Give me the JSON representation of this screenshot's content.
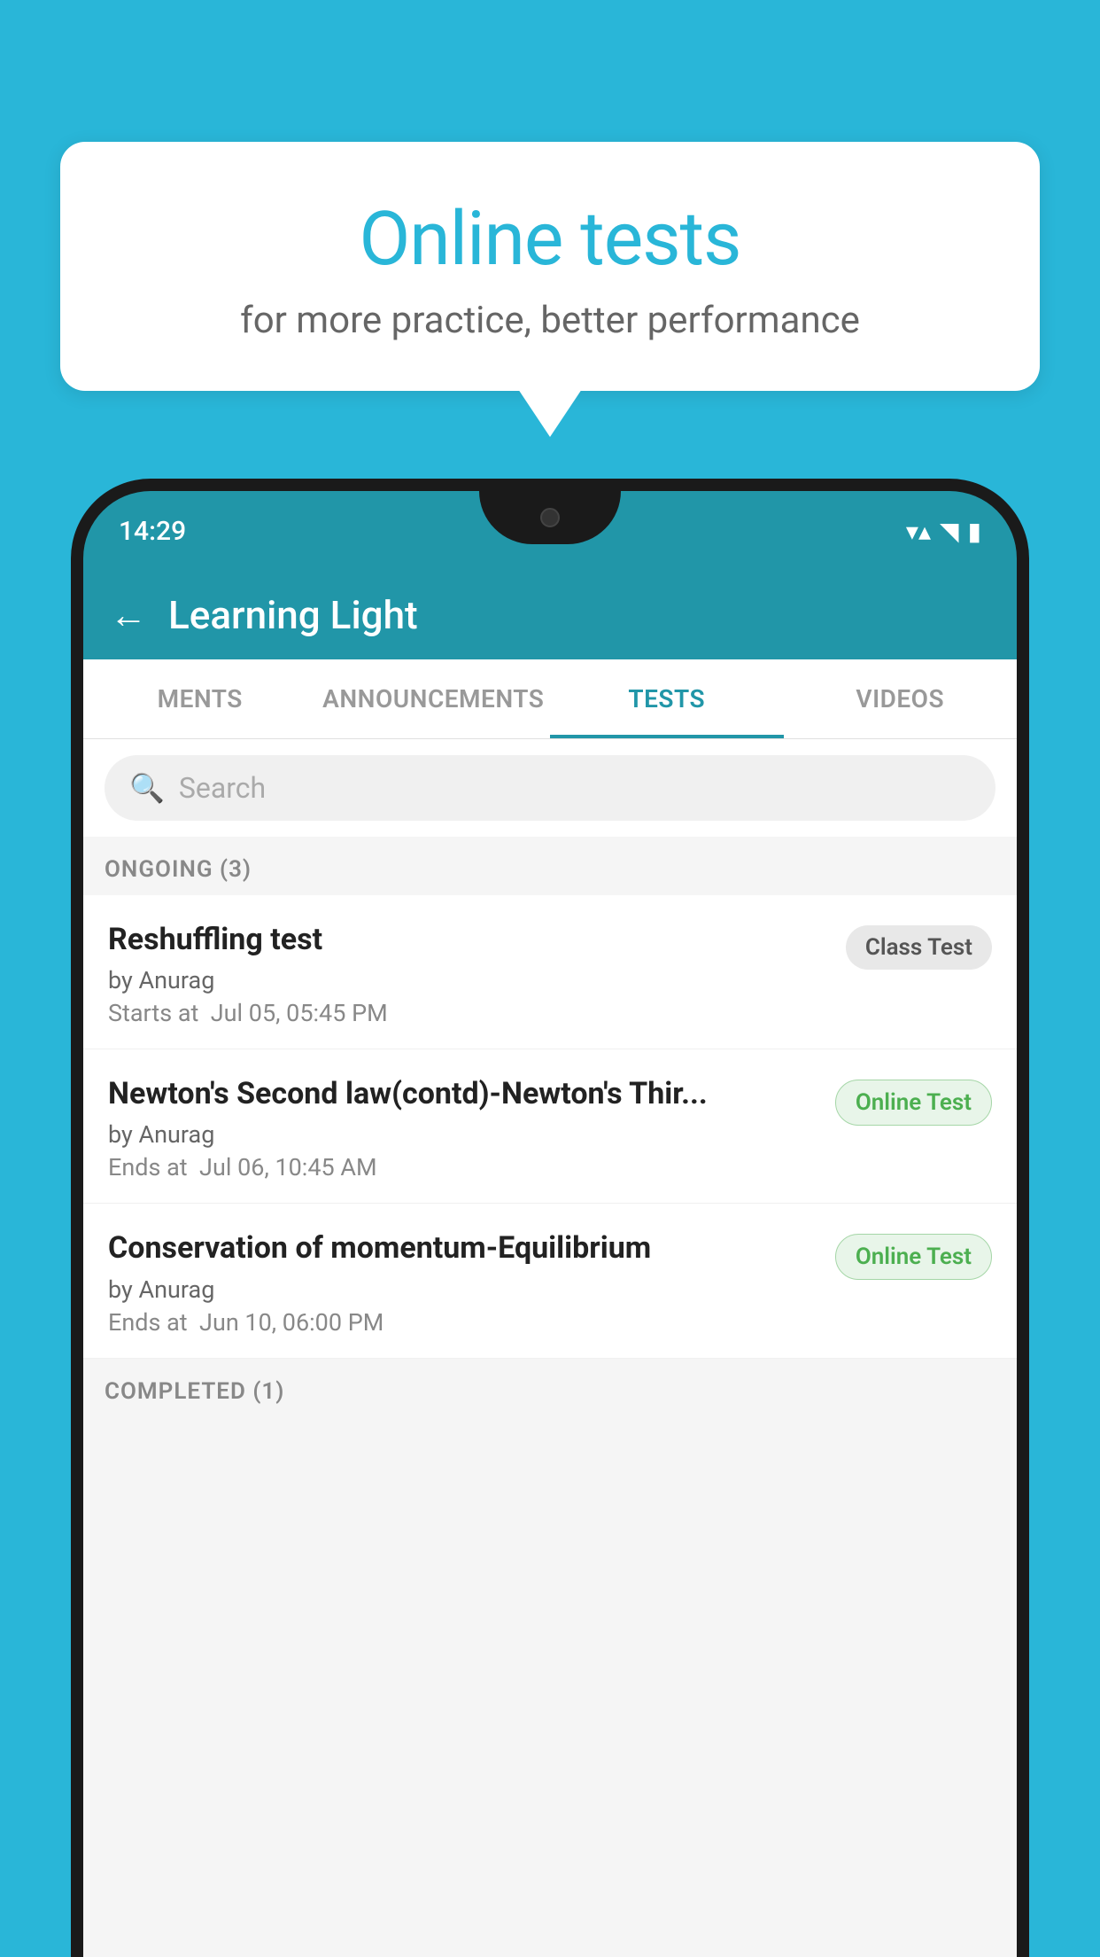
{
  "background_color": "#29b6d8",
  "bubble": {
    "title": "Online tests",
    "subtitle": "for more practice, better performance"
  },
  "status_bar": {
    "time": "14:29",
    "wifi": "▼",
    "signal": "▲",
    "battery": "▮"
  },
  "app_header": {
    "back_label": "←",
    "title": "Learning Light"
  },
  "tabs": [
    {
      "label": "MENTS",
      "active": false
    },
    {
      "label": "ANNOUNCEMENTS",
      "active": false
    },
    {
      "label": "TESTS",
      "active": true
    },
    {
      "label": "VIDEOS",
      "active": false
    }
  ],
  "search": {
    "placeholder": "Search"
  },
  "section_ongoing": {
    "label": "ONGOING (3)"
  },
  "tests": [
    {
      "name": "Reshuffling test",
      "by": "by Anurag",
      "time_label": "Starts at",
      "time_value": "Jul 05, 05:45 PM",
      "badge": "Class Test",
      "badge_type": "class"
    },
    {
      "name": "Newton's Second law(contd)-Newton's Thir...",
      "by": "by Anurag",
      "time_label": "Ends at",
      "time_value": "Jul 06, 10:45 AM",
      "badge": "Online Test",
      "badge_type": "online"
    },
    {
      "name": "Conservation of momentum-Equilibrium",
      "by": "by Anurag",
      "time_label": "Ends at",
      "time_value": "Jun 10, 06:00 PM",
      "badge": "Online Test",
      "badge_type": "online"
    }
  ],
  "section_completed": {
    "label": "COMPLETED (1)"
  }
}
